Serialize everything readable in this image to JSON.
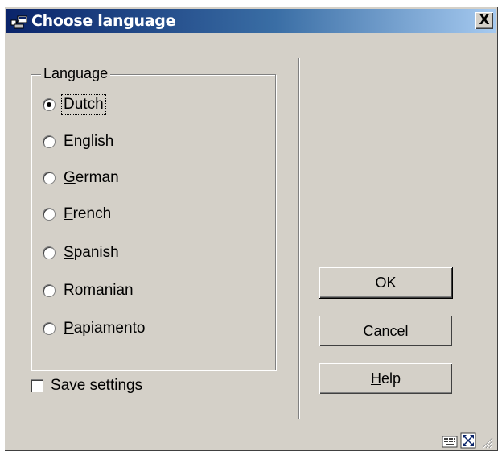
{
  "window": {
    "title": "Choose language",
    "close_label": "X"
  },
  "language_group": {
    "legend": "Language",
    "selected": "Dutch",
    "options": [
      {
        "mnemonic": "D",
        "rest": "utch",
        "selected": true
      },
      {
        "mnemonic": "E",
        "rest": "nglish",
        "selected": false
      },
      {
        "mnemonic": "G",
        "rest": "erman",
        "selected": false
      },
      {
        "mnemonic": "F",
        "rest": "rench",
        "selected": false
      },
      {
        "mnemonic": "S",
        "rest": "panish",
        "selected": false
      },
      {
        "mnemonic": "R",
        "rest": "omanian",
        "selected": false
      },
      {
        "mnemonic": "P",
        "rest": "apiamento",
        "selected": false
      }
    ]
  },
  "save_settings": {
    "mnemonic": "S",
    "rest": "ave settings",
    "checked": false
  },
  "buttons": {
    "ok": "OK",
    "cancel": "Cancel",
    "help_mnemonic": "H",
    "help_rest": "elp"
  },
  "statusbar": {
    "icons": [
      "keyboard-icon",
      "resize-icon",
      "size-grip-icon"
    ]
  }
}
